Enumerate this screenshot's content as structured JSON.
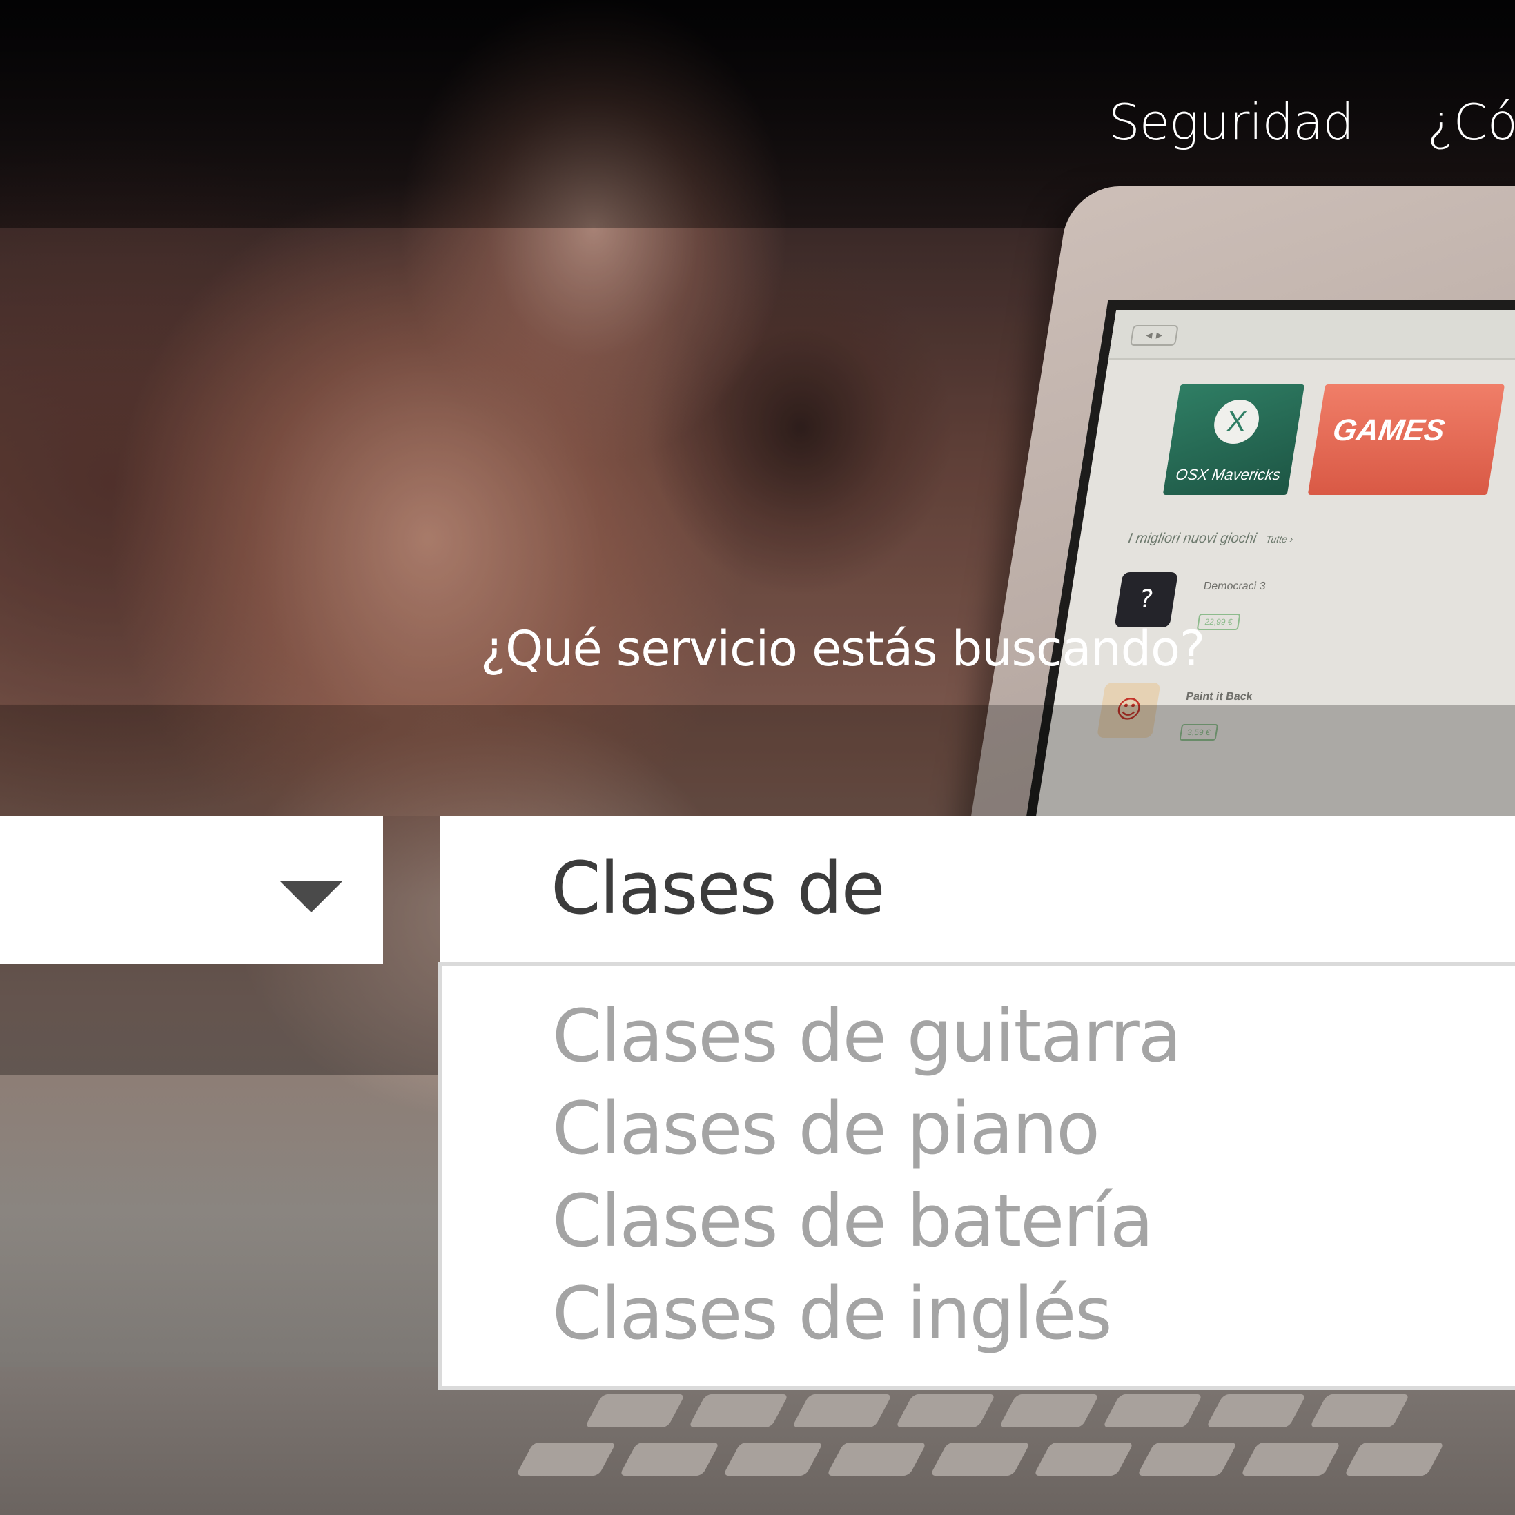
{
  "header": {
    "nav": {
      "seguridad": "Seguridad",
      "como": "¿Có"
    }
  },
  "hero": {
    "question": "¿Qué servicio estás buscando?"
  },
  "search": {
    "city_select": {
      "value": "",
      "icon": "chevron-down-icon"
    },
    "service_input": {
      "value": "Clases de"
    },
    "suggestions": [
      "Clases de guitarra",
      "Clases de piano",
      "Clases de batería",
      "Clases de inglés"
    ]
  },
  "background": {
    "laptop_screen": {
      "tile_osx_label": "OSX Mavericks",
      "tile_osx_badge": "X",
      "tile_games_label": "GAMES",
      "nav_arrows": "◂ ▸",
      "section_title": "I migliori nuovi giochi",
      "section_more": "Tutte ›",
      "games": [
        {
          "name": "Democraci 3",
          "price": "22,99 €",
          "icon": "?"
        },
        {
          "name": "Paint it Back",
          "price": "3,59 €",
          "icon": "☺"
        }
      ]
    }
  },
  "colors": {
    "text_dark": "#3c3c3c",
    "text_muted": "#a4a4a4",
    "suggestion_border": "#dadada",
    "caret": "#4a4a4a"
  }
}
